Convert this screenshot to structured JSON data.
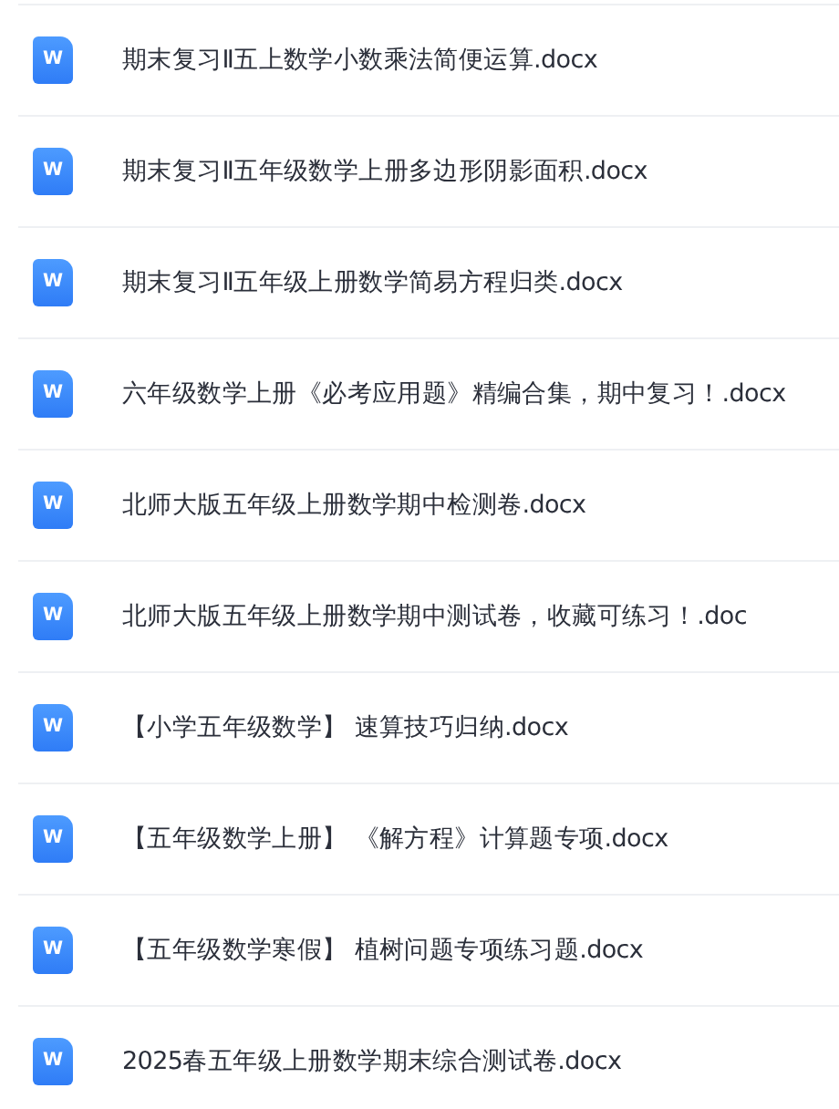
{
  "files": [
    {
      "icon_label": "W",
      "name": "期末复习Ⅱ五上数学小数乘法简便运算.docx"
    },
    {
      "icon_label": "W",
      "name": "期末复习Ⅱ五年级数学上册多边形阴影面积.docx"
    },
    {
      "icon_label": "W",
      "name": "期末复习Ⅱ五年级上册数学简易方程归类.docx"
    },
    {
      "icon_label": "W",
      "name": "六年级数学上册《必考应用题》精编合集，期中复习！.docx"
    },
    {
      "icon_label": "W",
      "name": "北师大版五年级上册数学期中检测卷.docx"
    },
    {
      "icon_label": "W",
      "name": "北师大版五年级上册数学期中测试卷，收藏可练习！.doc"
    },
    {
      "icon_label": "W",
      "name": "【小学五年级数学】 速算技巧归纳.docx"
    },
    {
      "icon_label": "W",
      "name": "【五年级数学上册】 《解方程》计算题专项.docx"
    },
    {
      "icon_label": "W",
      "name": "【五年级数学寒假】 植树问题专项练习题.docx"
    },
    {
      "icon_label": "W",
      "name": "2025春五年级上册数学期末综合测试卷.docx"
    }
  ]
}
